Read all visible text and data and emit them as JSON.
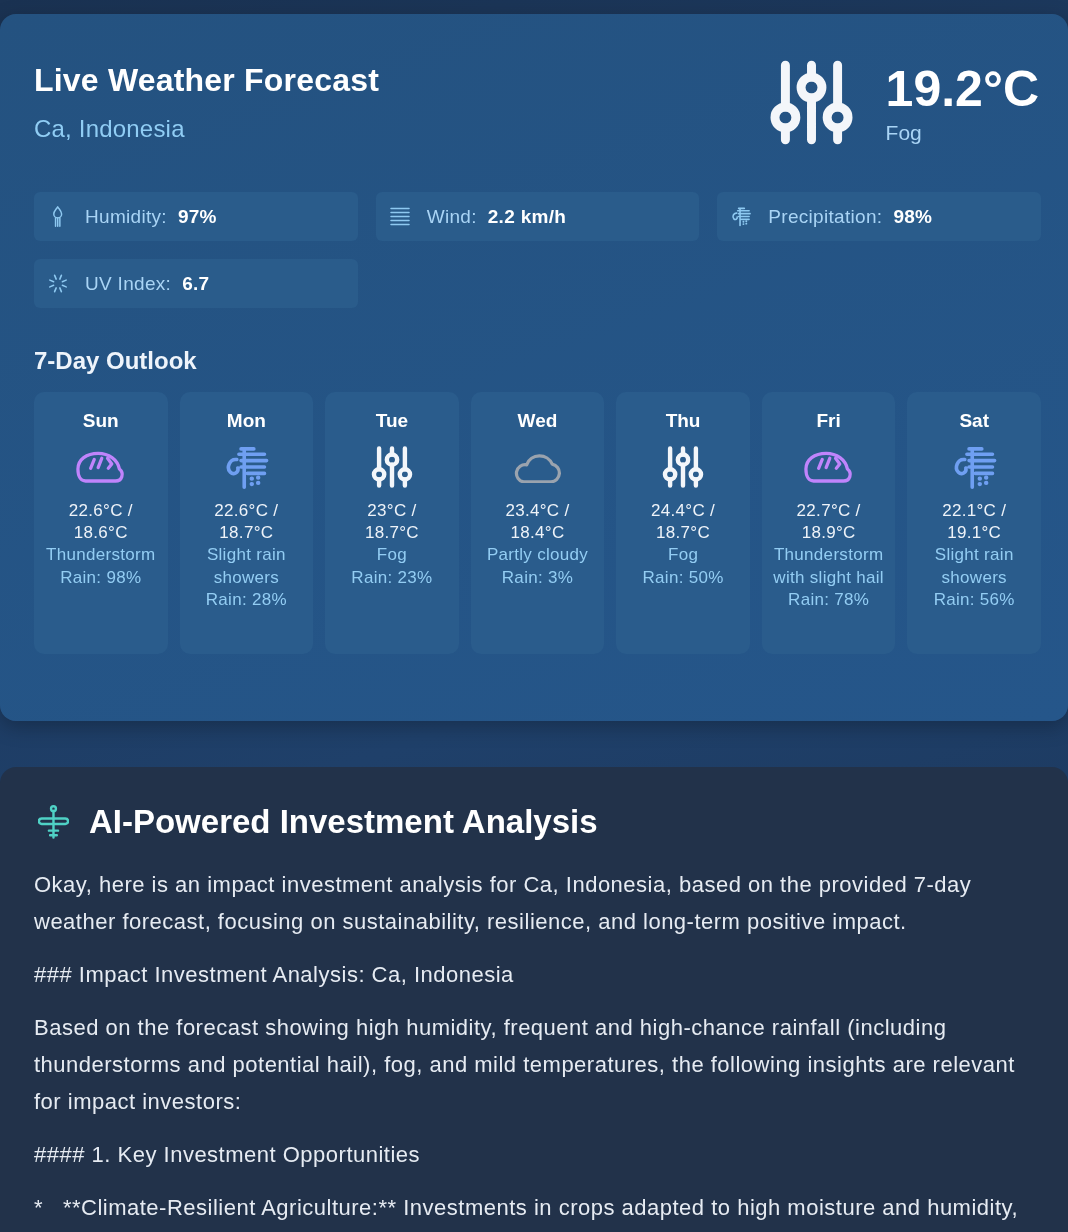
{
  "weather": {
    "title": "Live Weather Forecast",
    "location": "Ca, Indonesia",
    "current": {
      "kind": "fog",
      "temperature": "19.2°C",
      "condition": "Fog"
    },
    "metrics": [
      {
        "kind": "humidity",
        "label": "Humidity:",
        "value": "97%"
      },
      {
        "kind": "wind",
        "label": "Wind:",
        "value": "2.2 km/h"
      },
      {
        "kind": "precipitation",
        "label": "Precipitation:",
        "value": "98%"
      },
      {
        "kind": "uv",
        "label": "UV Index:",
        "value": "6.7"
      }
    ],
    "outlook": {
      "title": "7-Day Outlook",
      "days": [
        {
          "day": "Sun",
          "kind": "thunderstorm",
          "temperature_range": "22.6°C / 18.6°C",
          "condition": "Thunderstorm",
          "rain": "Rain: 98%"
        },
        {
          "day": "Mon",
          "kind": "rain",
          "temperature_range": "22.6°C / 18.7°C",
          "condition": "Slight rain showers",
          "rain": "Rain: 28%"
        },
        {
          "day": "Tue",
          "kind": "fog",
          "temperature_range": "23°C / 18.7°C",
          "condition": "Fog",
          "rain": "Rain: 23%"
        },
        {
          "day": "Wed",
          "kind": "cloudy",
          "temperature_range": "23.4°C / 18.4°C",
          "condition": "Partly cloudy",
          "rain": "Rain: 3%"
        },
        {
          "day": "Thu",
          "kind": "fog",
          "temperature_range": "24.4°C / 18.7°C",
          "condition": "Fog",
          "rain": "Rain: 50%"
        },
        {
          "day": "Fri",
          "kind": "thunderstorm",
          "temperature_range": "22.7°C / 18.9°C",
          "condition": "Thunderstorm with slight hail",
          "rain": "Rain: 78%"
        },
        {
          "day": "Sat",
          "kind": "rain",
          "temperature_range": "22.1°C / 19.1°C",
          "condition": "Slight rain showers",
          "rain": "Rain: 56%"
        }
      ]
    }
  },
  "analysis": {
    "title": "AI-Powered Investment Analysis",
    "paragraphs": [
      "Okay, here is an impact investment analysis for Ca, Indonesia, based on the provided 7-day weather forecast, focusing on sustainability, resilience, and long-term positive impact.",
      "### Impact Investment Analysis: Ca, Indonesia",
      "Based on the forecast showing high humidity, frequent and high-chance rainfall (including thunderstorms and potential hail), fog, and mild temperatures, the following insights are relevant for impact investors:",
      "#### 1. Key Investment Opportunities",
      "*   **Climate-Resilient Agriculture:** Investments in crops adapted to high moisture and humidity,"
    ]
  }
}
